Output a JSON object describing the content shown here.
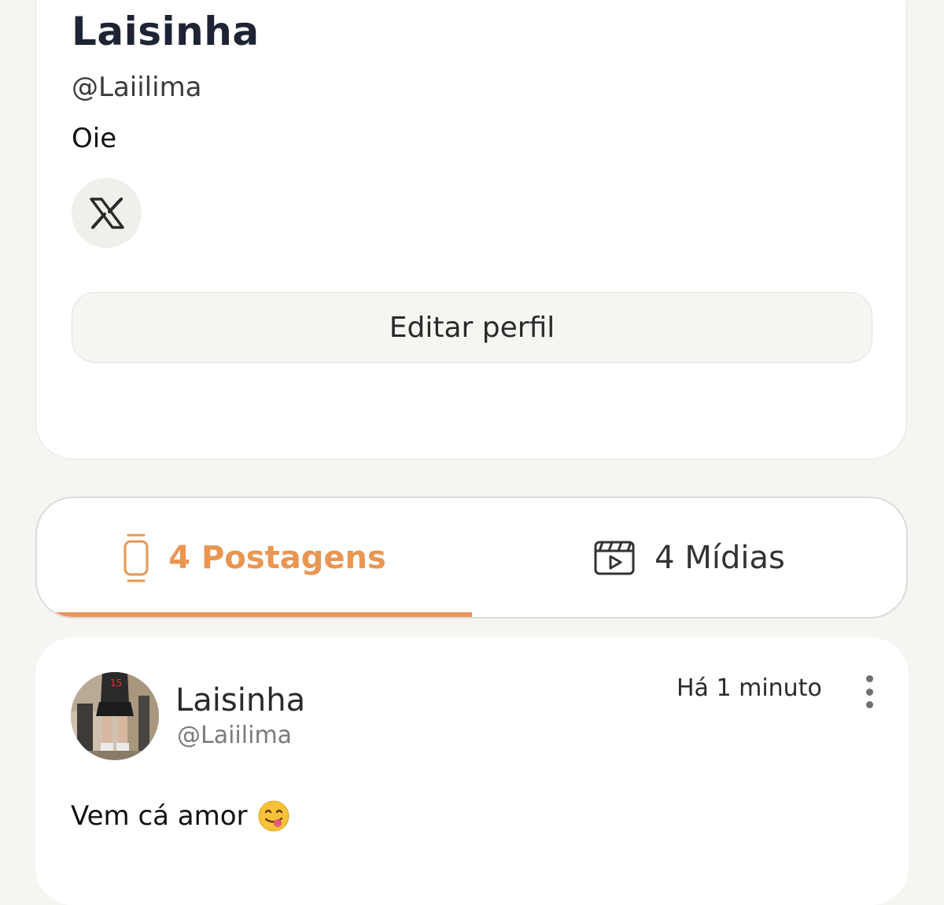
{
  "profile": {
    "display_name": "Laisinha",
    "handle": "@Laiilima",
    "bio": "Oie",
    "edit_button_label": "Editar perfil"
  },
  "tabs": [
    {
      "label": "4 Postagens",
      "icon": "phone-icon",
      "active": true
    },
    {
      "label": "4 Mídias",
      "icon": "video-clapper-icon",
      "active": false
    }
  ],
  "post": {
    "author_name": "Laisinha",
    "author_handle": "@Laiilima",
    "timestamp": "Há 1 minuto",
    "text": "Vem cá amor",
    "emoji": "yum-face-emoji"
  },
  "colors": {
    "accent": "#e8955a",
    "background": "#f6f5f2",
    "card": "#ffffff"
  }
}
